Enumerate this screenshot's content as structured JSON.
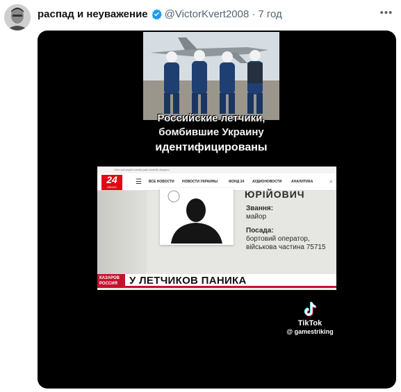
{
  "tweet": {
    "author_name": "распад и неуважение",
    "handle": "@VictorKvert2008",
    "separator": "·",
    "time": "7 год",
    "more_label": "•••"
  },
  "video": {
    "caption_line1": "Российские летчики,",
    "caption_line2": "бомбившие Украину",
    "caption_line3": "идентифицированы",
    "browser": {
      "address_text": "24tv.ua/rosiyski-lotchiki-yaki-bombili-ukrayinu",
      "logo_number": "24",
      "logo_sub": "КАНАЛ",
      "nav": [
        "ВСЕ НОВОСТИ",
        "НОВОСТИ УКРАИНЫ",
        "ФОНД 24",
        "АУДИОНОВОСТИ",
        "АНАЛИТИКА"
      ]
    },
    "document": {
      "surname": "ЮРІЙОВИЧ",
      "rank_label": "Звання:",
      "rank_value": "майор",
      "position_label": "Посада:",
      "position_value_1": "бортовий оператор,",
      "position_value_2": "військова частина 75715"
    },
    "lower_third": {
      "tag_line1": "КАЗАРОВ",
      "tag_line2": "РОССИЯ",
      "headline": "У ЛЕТЧИКОВ ПАНИКА"
    },
    "watermark": {
      "brand": "TikTok",
      "user": "@ gamestriking"
    }
  },
  "colors": {
    "verified": "#1d9bf0",
    "accent_red": "#e30613",
    "text_primary": "#0f1419",
    "text_secondary": "#536471"
  }
}
